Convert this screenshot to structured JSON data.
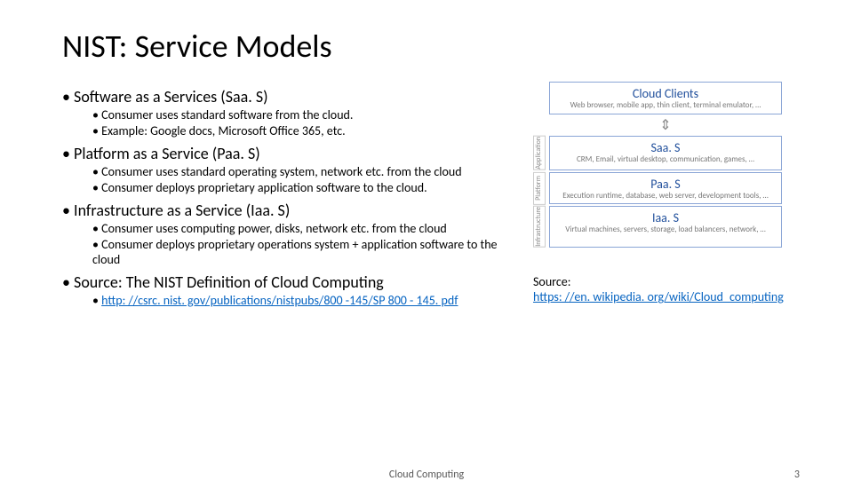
{
  "title": "NIST: Service Models",
  "bullets": [
    {
      "text": "Software as a Services (Saa. S)",
      "subs": [
        "Consumer uses standard software from the cloud.",
        "Example: Google docs, Microsoft Office 365, etc."
      ]
    },
    {
      "text": "Platform as a Service (Paa. S)",
      "subs": [
        "Consumer uses standard operating system, network etc. from the cloud",
        "Consumer deploys proprietary application software to the cloud."
      ]
    },
    {
      "text": "Infrastructure as a Service (Iaa. S)",
      "subs": [
        "Consumer uses computing power, disks, network etc. from the cloud",
        "Consumer deploys proprietary operations system + application software to the cloud"
      ]
    },
    {
      "text": "Source: The NIST Definition of Cloud Computing",
      "subs": [],
      "link": "http: //csrc. nist. gov/publications/nistpubs/800 -145/SP 800 - 145. pdf"
    }
  ],
  "diagram": {
    "clients": {
      "title": "Cloud Clients",
      "sub": "Web browser, mobile app, thin client, terminal emulator, …"
    },
    "app_label": "Application",
    "saas": {
      "title": "Saa. S",
      "sub": "CRM, Email, virtual desktop, communication, games, …"
    },
    "plat_label": "Platform",
    "paas": {
      "title": "Paa. S",
      "sub": "Execution runtime, database, web server, development tools, …"
    },
    "infra_label": "Infrastructure",
    "iaas": {
      "title": "Iaa. S",
      "sub": "Virtual machines, servers, storage, load balancers, network, …"
    }
  },
  "right_source": {
    "label": "Source:",
    "link": "https: //en. wikipedia. org/wiki/Cloud_computing"
  },
  "footer": {
    "center": "Cloud Computing",
    "page": "3"
  }
}
